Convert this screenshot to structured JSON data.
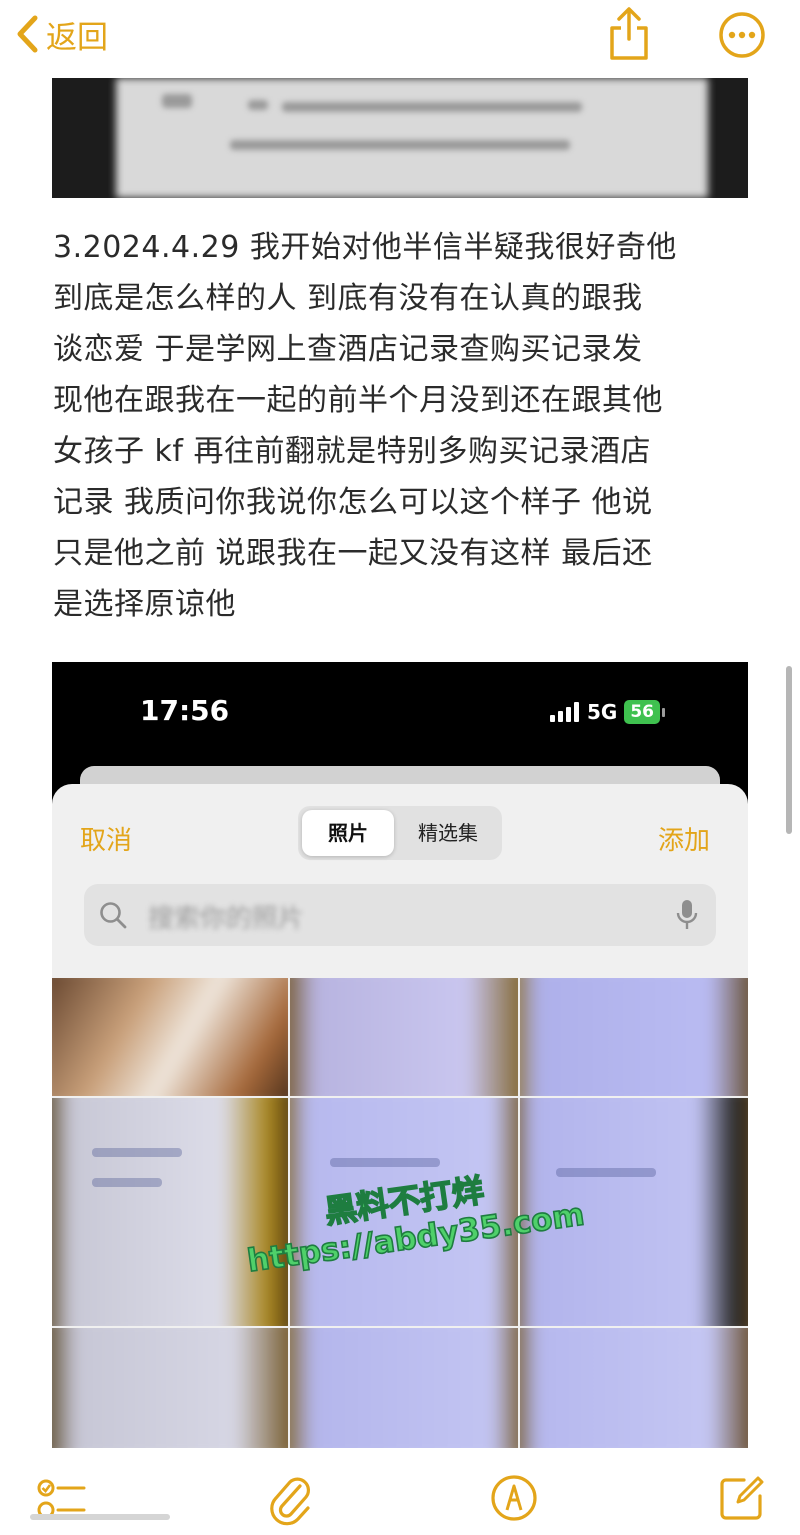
{
  "nav": {
    "back_label": "返回",
    "accent_color": "#e3a51a",
    "share_icon": "share-icon",
    "more_icon": "ellipsis-circle-icon"
  },
  "note": {
    "paragraph": "3.2024.4.29 我开始对他半信半疑我很好奇他\n到底是怎么样的人 到底有没有在认真的跟我\n谈恋爱 于是学网上查酒店记录查购买记录发\n现他在跟我在一起的前半个月没到还在跟其他\n女孩子 kf 再往前翻就是特别多购买记录酒店\n记录 我质问你我说你怎么可以这个样子 他说\n只是他之前 说跟我在一起又没有这样 最后还\n是选择原谅他"
  },
  "screenshot": {
    "status_time": "17:56",
    "network": "5G",
    "battery": "56",
    "picker": {
      "cancel_label": "取消",
      "add_label": "添加",
      "tabs": [
        {
          "label": "照片",
          "selected": true
        },
        {
          "label": "精选集",
          "selected": false
        }
      ],
      "search_placeholder": "搜索你的照片"
    }
  },
  "watermark": {
    "line1": "黑料不打烊",
    "line2": "https://abdy35.com",
    "color": "#4fd06a"
  },
  "toolbar": {
    "icons": [
      "checklist-icon",
      "paperclip-icon",
      "markup-pen-icon",
      "compose-icon"
    ]
  }
}
